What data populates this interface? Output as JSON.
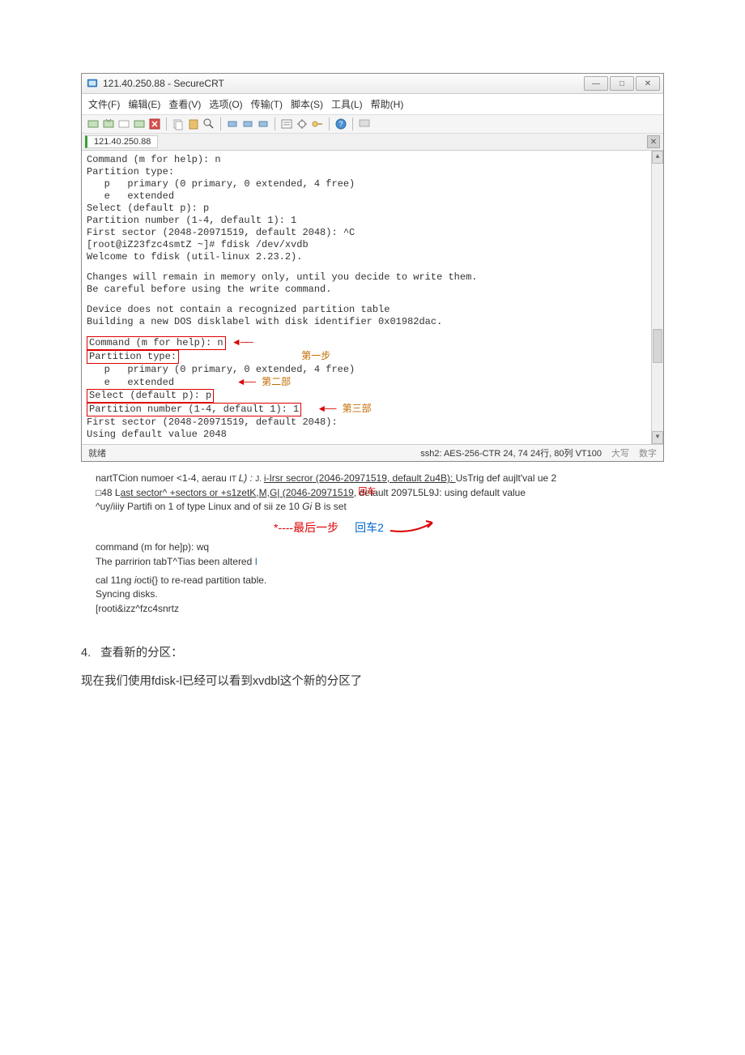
{
  "window": {
    "title": "121.40.250.88 - SecureCRT",
    "min_tip": "—",
    "max_tip": "□",
    "close_tip": "✕"
  },
  "menu": {
    "file": "文件(F)",
    "edit": "编辑(E)",
    "view": "查看(V)",
    "options": "选项(O)",
    "transfer": "传输(T)",
    "script": "脚本(S)",
    "tools": "工具(L)",
    "help": "帮助(H)"
  },
  "tab": {
    "label": "121.40.250.88",
    "close": "✕"
  },
  "terminal": {
    "block1": "Command (m for help): n\nPartition type:\n   p   primary (0 primary, 0 extended, 4 free)\n   e   extended\nSelect (default p): p\nPartition number (1-4, default 1): 1\nFirst sector (2048-20971519, default 2048): ^C\n[root@iZ23fzc4smtZ ~]# fdisk /dev/xvdb\nWelcome to fdisk (util-linux 2.23.2).",
    "block2": "Changes will remain in memory only, until you decide to write them.\nBe careful before using the write command.",
    "block3": "Device does not contain a recognized partition table\nBuilding a new DOS disklabel with disk identifier 0x01982dac.",
    "cmd_line": "Command (m for help): n",
    "ptype_head": "Partition type:",
    "ptype_p": "   p   primary (0 primary, 0 extended, 4 free)",
    "ptype_e": "   e   extended",
    "select_line": "Select (default p): p",
    "partnum_line": "Partition number (1-4, default 1): 1",
    "firstsec_line": "First sector (2048-20971519, default 2048):",
    "usingdef_line": "Using default value 2048",
    "annot_step1": "第一步",
    "annot_step2": "第二部",
    "annot_step3": "第三部"
  },
  "status": {
    "ready": "就绪",
    "conn": "ssh2: AES-256-CTR   24,  74    24行, 80列   VT100",
    "caps": "大写",
    "num": "数字"
  },
  "below": {
    "l1a": "nartTCion numoer <1-4, aerau ",
    "l1b": "IT ",
    "l1c": "L) : ",
    "l1d": "J. ",
    "l1e": "i-Irsr secror (2046-20971519, default 2u4B): ",
    "l1f": "UsTrig def aujlt'val ue 2",
    "l2a": "□48 L",
    "l2b": "ast sector^ +sectors or +s1zetK,M,G| (2046-20971519",
    "l2c": ", detault 2097L5L9J: using default value",
    "l2_ann": "回车",
    "l3": "^uy/iiiy Partifi on 1 of type Linux and of sii ze 10 ",
    "l3i": "Gi",
    "l3b": " B is set",
    "last_step": "*----最后一步",
    "huiche2": "回车2",
    "cmd_wq": "command (m for he]p): wq",
    "altered": " The parririon tabT^Tias been altered ",
    "altered_i": "I",
    "ioctl": "cal 11ng ",
    "ioctl_i": "i",
    "ioctl_b": "octi{} to re-read partition table.",
    "sync": "Syncing disks.",
    "prompt": "[rooti&izz^fzc4snrtz"
  },
  "doc": {
    "heading_num": "4.",
    "heading_text": "查看新的分区：",
    "para": "现在我们使用fdisk-l已经可以看到xvdbl这个新的分区了"
  }
}
